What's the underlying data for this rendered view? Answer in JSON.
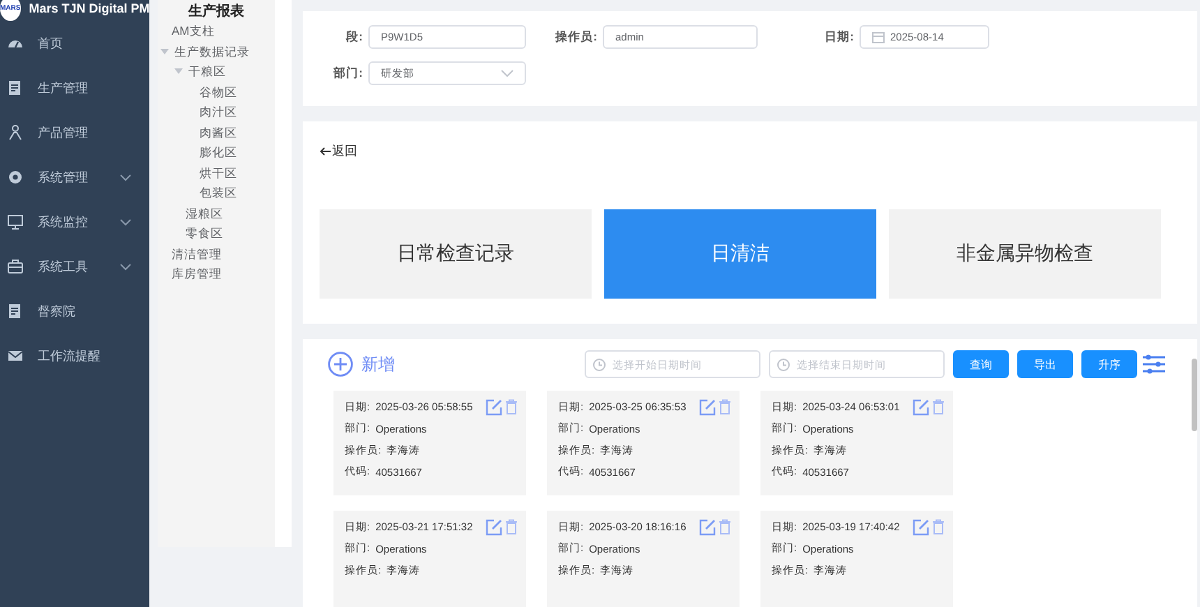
{
  "app": {
    "logo_text": "MARS",
    "title": "Mars TJN Digital PM"
  },
  "sidebar": {
    "items": [
      {
        "label": "首页",
        "expandable": false
      },
      {
        "label": "生产管理",
        "expandable": false
      },
      {
        "label": "产品管理",
        "expandable": false
      },
      {
        "label": "系统管理",
        "expandable": true
      },
      {
        "label": "系统监控",
        "expandable": true
      },
      {
        "label": "系统工具",
        "expandable": true
      },
      {
        "label": "督察院",
        "expandable": false
      },
      {
        "label": "工作流提醒",
        "expandable": false
      }
    ]
  },
  "tree": {
    "title": "生产报表",
    "items": [
      {
        "label": "AM支柱"
      },
      {
        "label": "生产数据记录",
        "expanded": true,
        "children": [
          {
            "label": "干粮区",
            "expanded": true,
            "children": [
              {
                "label": "谷物区"
              },
              {
                "label": "肉汁区"
              },
              {
                "label": "肉酱区"
              },
              {
                "label": "膨化区"
              },
              {
                "label": "烘干区"
              },
              {
                "label": "包装区"
              }
            ]
          },
          {
            "label": "湿粮区"
          },
          {
            "label": "零食区"
          }
        ]
      },
      {
        "label": "清洁管理"
      },
      {
        "label": "库房管理"
      }
    ]
  },
  "form": {
    "fields": [
      {
        "label": "段:",
        "value": "P9W1D5",
        "kind": "text"
      },
      {
        "label": "操作员:",
        "value": "admin",
        "kind": "text"
      },
      {
        "label": "日期:",
        "value": "2025-08-14",
        "kind": "date"
      },
      {
        "label": "部门:",
        "value": "研发部",
        "kind": "select"
      }
    ]
  },
  "back_link": "返回",
  "record_types": [
    {
      "label": "日常检查记录",
      "selected": false
    },
    {
      "label": "日清洁",
      "selected": true
    },
    {
      "label": "非金属异物检查",
      "selected": false
    }
  ],
  "toolbar": {
    "add": "新增",
    "start_placeholder": "选择开始日期时间",
    "end_placeholder": "选择结束日期时间",
    "buttons": [
      "查询",
      "导出",
      "升序"
    ]
  },
  "records": [
    {
      "fields": [
        {
          "label": "日期:",
          "value": "2025-03-26 05:58:55"
        },
        {
          "label": "部门:",
          "value": "Operations"
        },
        {
          "label": "操作员:",
          "value": "李海涛"
        },
        {
          "label": "代码:",
          "value": "40531667"
        }
      ]
    },
    {
      "fields": [
        {
          "label": "日期:",
          "value": "2025-03-25 06:35:53"
        },
        {
          "label": "部门:",
          "value": "Operations"
        },
        {
          "label": "操作员:",
          "value": "李海涛"
        },
        {
          "label": "代码:",
          "value": "40531667"
        }
      ]
    },
    {
      "fields": [
        {
          "label": "日期:",
          "value": "2025-03-24 06:53:01"
        },
        {
          "label": "部门:",
          "value": "Operations"
        },
        {
          "label": "操作员:",
          "value": "李海涛"
        },
        {
          "label": "代码:",
          "value": "40531667"
        }
      ]
    },
    {
      "fields": [
        {
          "label": "日期:",
          "value": "2025-03-21 17:51:32"
        },
        {
          "label": "部门:",
          "value": "Operations"
        },
        {
          "label": "操作员:",
          "value": "李海涛"
        }
      ]
    },
    {
      "fields": [
        {
          "label": "日期:",
          "value": "2025-03-20 18:16:16"
        },
        {
          "label": "部门:",
          "value": "Operations"
        },
        {
          "label": "操作员:",
          "value": "李海涛"
        }
      ]
    },
    {
      "fields": [
        {
          "label": "日期:",
          "value": "2025-03-19 17:40:42"
        },
        {
          "label": "部门:",
          "value": "Operations"
        },
        {
          "label": "操作员:",
          "value": "李海涛"
        }
      ]
    }
  ]
}
